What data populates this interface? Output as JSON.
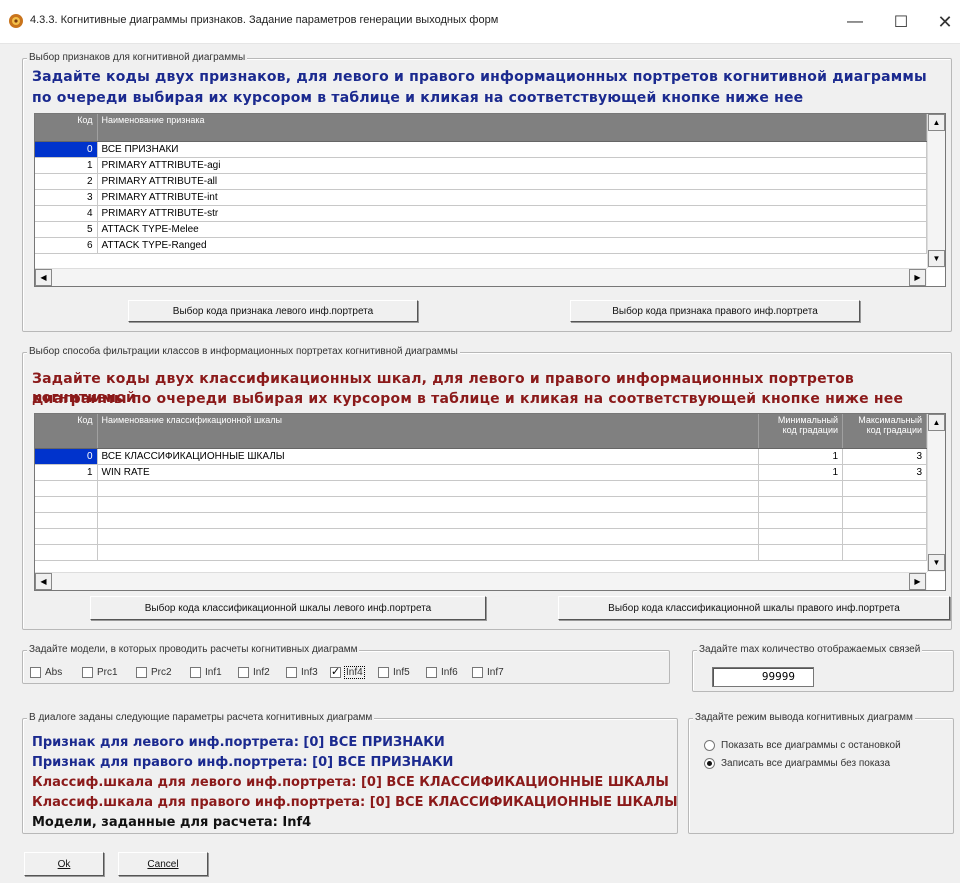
{
  "window": {
    "title": "4.3.3. Когнитивные диаграммы признаков. Задание параметров генерации выходных форм",
    "minimize": "—",
    "maximize": "☐",
    "close": "✕"
  },
  "group1": {
    "legend": "Выбор признаков для когнитивной диаграммы",
    "heading_line1": "Задайте коды двух признаков, для левого и правого информационных портретов когнитивной диаграммы",
    "heading_line2": "по очереди выбирая их курсором в таблице и кликая на соответствующей кнопке ниже нее",
    "columns": [
      "Код",
      "Наименование признака"
    ],
    "rows": [
      {
        "code": "0",
        "name": "ВСЕ ПРИЗНАКИ"
      },
      {
        "code": "1",
        "name": "PRIMARY ATTRIBUTE-agi"
      },
      {
        "code": "2",
        "name": "PRIMARY ATTRIBUTE-all"
      },
      {
        "code": "3",
        "name": "PRIMARY ATTRIBUTE-int"
      },
      {
        "code": "4",
        "name": "PRIMARY ATTRIBUTE-str"
      },
      {
        "code": "5",
        "name": "ATTACK TYPE-Melee"
      },
      {
        "code": "6",
        "name": "ATTACK TYPE-Ranged"
      }
    ],
    "btn_left": "Выбор кода признака левого инф.портрета",
    "btn_right": "Выбор кода признака правого инф.портрета"
  },
  "group2": {
    "legend": "Выбор способа фильтрации классов в информационных портретах когнитивной диаграммы",
    "heading_line1": "Задайте коды двух классификационных шкал, для левого и правого информационных портретов когнитивной",
    "heading_line2": "диаграммы по очереди выбирая их курсором в таблице и кликая на соответствующей кнопке ниже нее",
    "columns": [
      "Код",
      "Наименование классификационной шкалы",
      "Минимальный код градации",
      "Максимальный код градации"
    ],
    "rows": [
      {
        "code": "0",
        "name": "ВСЕ КЛАССИФИКАЦИОННЫЕ ШКАЛЫ",
        "min": "1",
        "max": "3"
      },
      {
        "code": "1",
        "name": "WIN RATE",
        "min": "1",
        "max": "3"
      }
    ],
    "btn_left": "Выбор кода классификационной шкалы левого инф.портрета",
    "btn_right": "Выбор кода классификационной шкалы правого инф.портрета"
  },
  "models": {
    "legend": "Задайте модели, в которых проводить расчеты когнитивных диаграмм",
    "items": [
      {
        "label": "Abs",
        "checked": false
      },
      {
        "label": "Prc1",
        "checked": false
      },
      {
        "label": "Prc2",
        "checked": false
      },
      {
        "label": "Inf1",
        "checked": false
      },
      {
        "label": "Inf2",
        "checked": false
      },
      {
        "label": "Inf3",
        "checked": false
      },
      {
        "label": "Inf4",
        "checked": true
      },
      {
        "label": "Inf5",
        "checked": false
      },
      {
        "label": "Inf6",
        "checked": false
      },
      {
        "label": "Inf7",
        "checked": false
      }
    ]
  },
  "maxlinks": {
    "legend": "Задайте max количество отображаемых связей",
    "value": "99999"
  },
  "summary": {
    "legend": "В диалоге заданы следующие параметры расчета когнитивных диаграмм",
    "line1": "Признак для левого инф.портрета:  [0] ВСЕ ПРИЗНАКИ",
    "line2": "Признак для правого инф.портрета: [0] ВСЕ ПРИЗНАКИ",
    "line3": "Классиф.шкала для левого инф.портрета:  [0] ВСЕ КЛАССИФИКАЦИОННЫЕ ШКАЛЫ",
    "line4": "Классиф.шкала для правого инф.портрета: [0] ВСЕ КЛАССИФИКАЦИОННЫЕ ШКАЛЫ",
    "line5": "Модели, заданные для расчета: Inf4"
  },
  "mode": {
    "legend": "Задайте режим вывода когнитивных диаграмм",
    "options": [
      {
        "label": "Показать все диаграммы с остановкой",
        "selected": false
      },
      {
        "label": "Записать все диаграммы без показа",
        "selected": true
      }
    ]
  },
  "footer": {
    "ok": "Ok",
    "cancel": "Cancel"
  },
  "colors": {
    "blue_text": "#1b2a8f",
    "red_text": "#8b1a1a",
    "selection": "#0033cc",
    "grid_header": "#808080"
  }
}
